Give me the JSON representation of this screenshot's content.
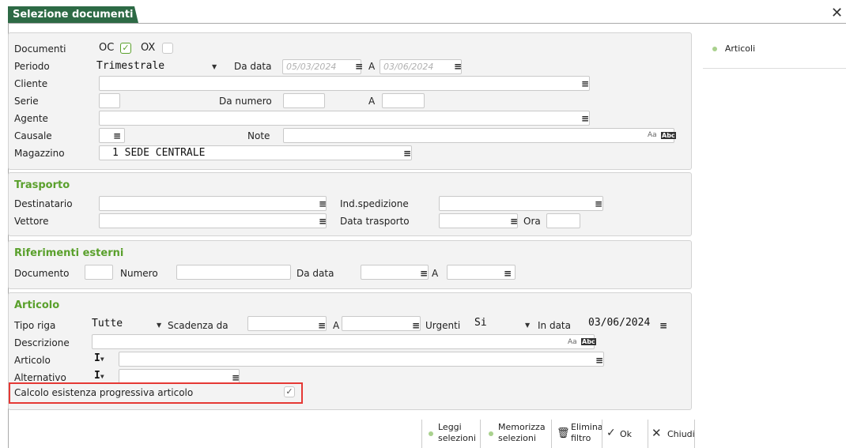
{
  "window": {
    "title": "Selezione documenti",
    "close": "✕"
  },
  "side": {
    "item": "Articoli"
  },
  "doc": {
    "documenti_label": "Documenti",
    "oc": "OC",
    "ox": "OX",
    "periodo_label": "Periodo",
    "periodo_value": "Trimestrale",
    "da_data_label": "Da data",
    "da_data_value": "05/03/2024",
    "a_label": "A",
    "a_data_value": "03/06/2024",
    "cliente_label": "Cliente",
    "serie_label": "Serie",
    "da_numero_label": "Da numero",
    "a_numero_label": "A",
    "agente_label": "Agente",
    "causale_label": "Causale",
    "note_label": "Note",
    "magazzino_label": "Magazzino",
    "magazzino_value": "1  SEDE CENTRALE"
  },
  "trasporto": {
    "title": "Trasporto",
    "destinatario": "Destinatario",
    "ind_spedizione": "Ind.spedizione",
    "vettore": "Vettore",
    "data_trasporto": "Data trasporto",
    "ora": "Ora"
  },
  "riferimenti": {
    "title": "Riferimenti esterni",
    "documento": "Documento",
    "numero": "Numero",
    "da_data": "Da data",
    "a": "A"
  },
  "articolo": {
    "title": "Articolo",
    "tipo_riga_label": "Tipo riga",
    "tipo_riga_value": "Tutte",
    "scadenza_da": "Scadenza da",
    "a": "A",
    "urgenti_label": "Urgenti",
    "urgenti_value": "Si",
    "in_data_label": "In data",
    "in_data_value": "03/06/2024",
    "descrizione": "Descrizione",
    "articolo_label": "Articolo",
    "articolo_mode": "I",
    "alternativo_label": "Alternativo",
    "alternativo_mode": "I",
    "calcolo_label": "Calcolo esistenza progressiva articolo"
  },
  "buttons": {
    "leggi1": "Leggi",
    "leggi2": "selezioni",
    "memorizza1": "Memorizza",
    "memorizza2": "selezioni",
    "elimina1": "Elimina",
    "elimina2": "filtro",
    "ok": "Ok",
    "chiudi": "Chiudi"
  },
  "colors": {
    "tab": "#2d6a45",
    "section": "#5aa02c",
    "highlight": "#e53935"
  }
}
